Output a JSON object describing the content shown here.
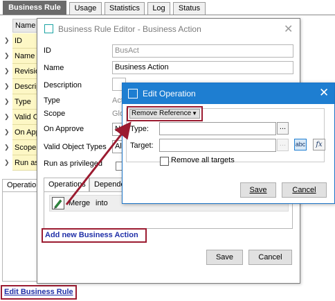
{
  "main": {
    "tabs": [
      {
        "label": "Business Rule",
        "active": true
      },
      {
        "label": "Usage"
      },
      {
        "label": "Statistics"
      },
      {
        "label": "Log"
      },
      {
        "label": "Status"
      }
    ],
    "grid_header": "Name",
    "grid_rows": [
      "ID",
      "Name",
      "Revisio",
      "Descrip",
      "Type",
      "Valid O",
      "On App",
      "Scope",
      "Run as"
    ],
    "lower_tab": "Operatio",
    "edit_link": "Edit Business Rule"
  },
  "editor_dialog": {
    "title": "Business Rule Editor - Business Action",
    "fields": {
      "id_label": "ID",
      "id_value": "BusAct",
      "name_label": "Name",
      "name_value": "Business Action",
      "description_label": "Description",
      "type_label": "Type",
      "type_value": "Act",
      "scope_label": "Scope",
      "scope_value": "Glo",
      "on_approve_label": "On Approve",
      "on_approve_value": "No",
      "valid_types_label": "Valid Object Types",
      "valid_types_value": "All",
      "run_priv_label": "Run as privileged"
    },
    "tabs": [
      "Operations",
      "Depende"
    ],
    "operation": {
      "name": "Merge",
      "suffix": "into"
    },
    "add_link": "Add new Business Action",
    "save": "Save",
    "cancel": "Cancel"
  },
  "op_dialog": {
    "title": "Edit Operation",
    "operation_select": "Remove Reference",
    "type_label": "Type:",
    "target_label": "Target:",
    "dots": "...",
    "abc_label": "abc",
    "fx_label": "fx",
    "remove_all_label": "Remove all targets",
    "save": "Save",
    "cancel": "Cancel"
  },
  "colors": {
    "highlight": "#9b1b30",
    "link": "#1f2fa8",
    "title_bar": "#1e7ed1",
    "grid_row": "#fdf7c5"
  }
}
